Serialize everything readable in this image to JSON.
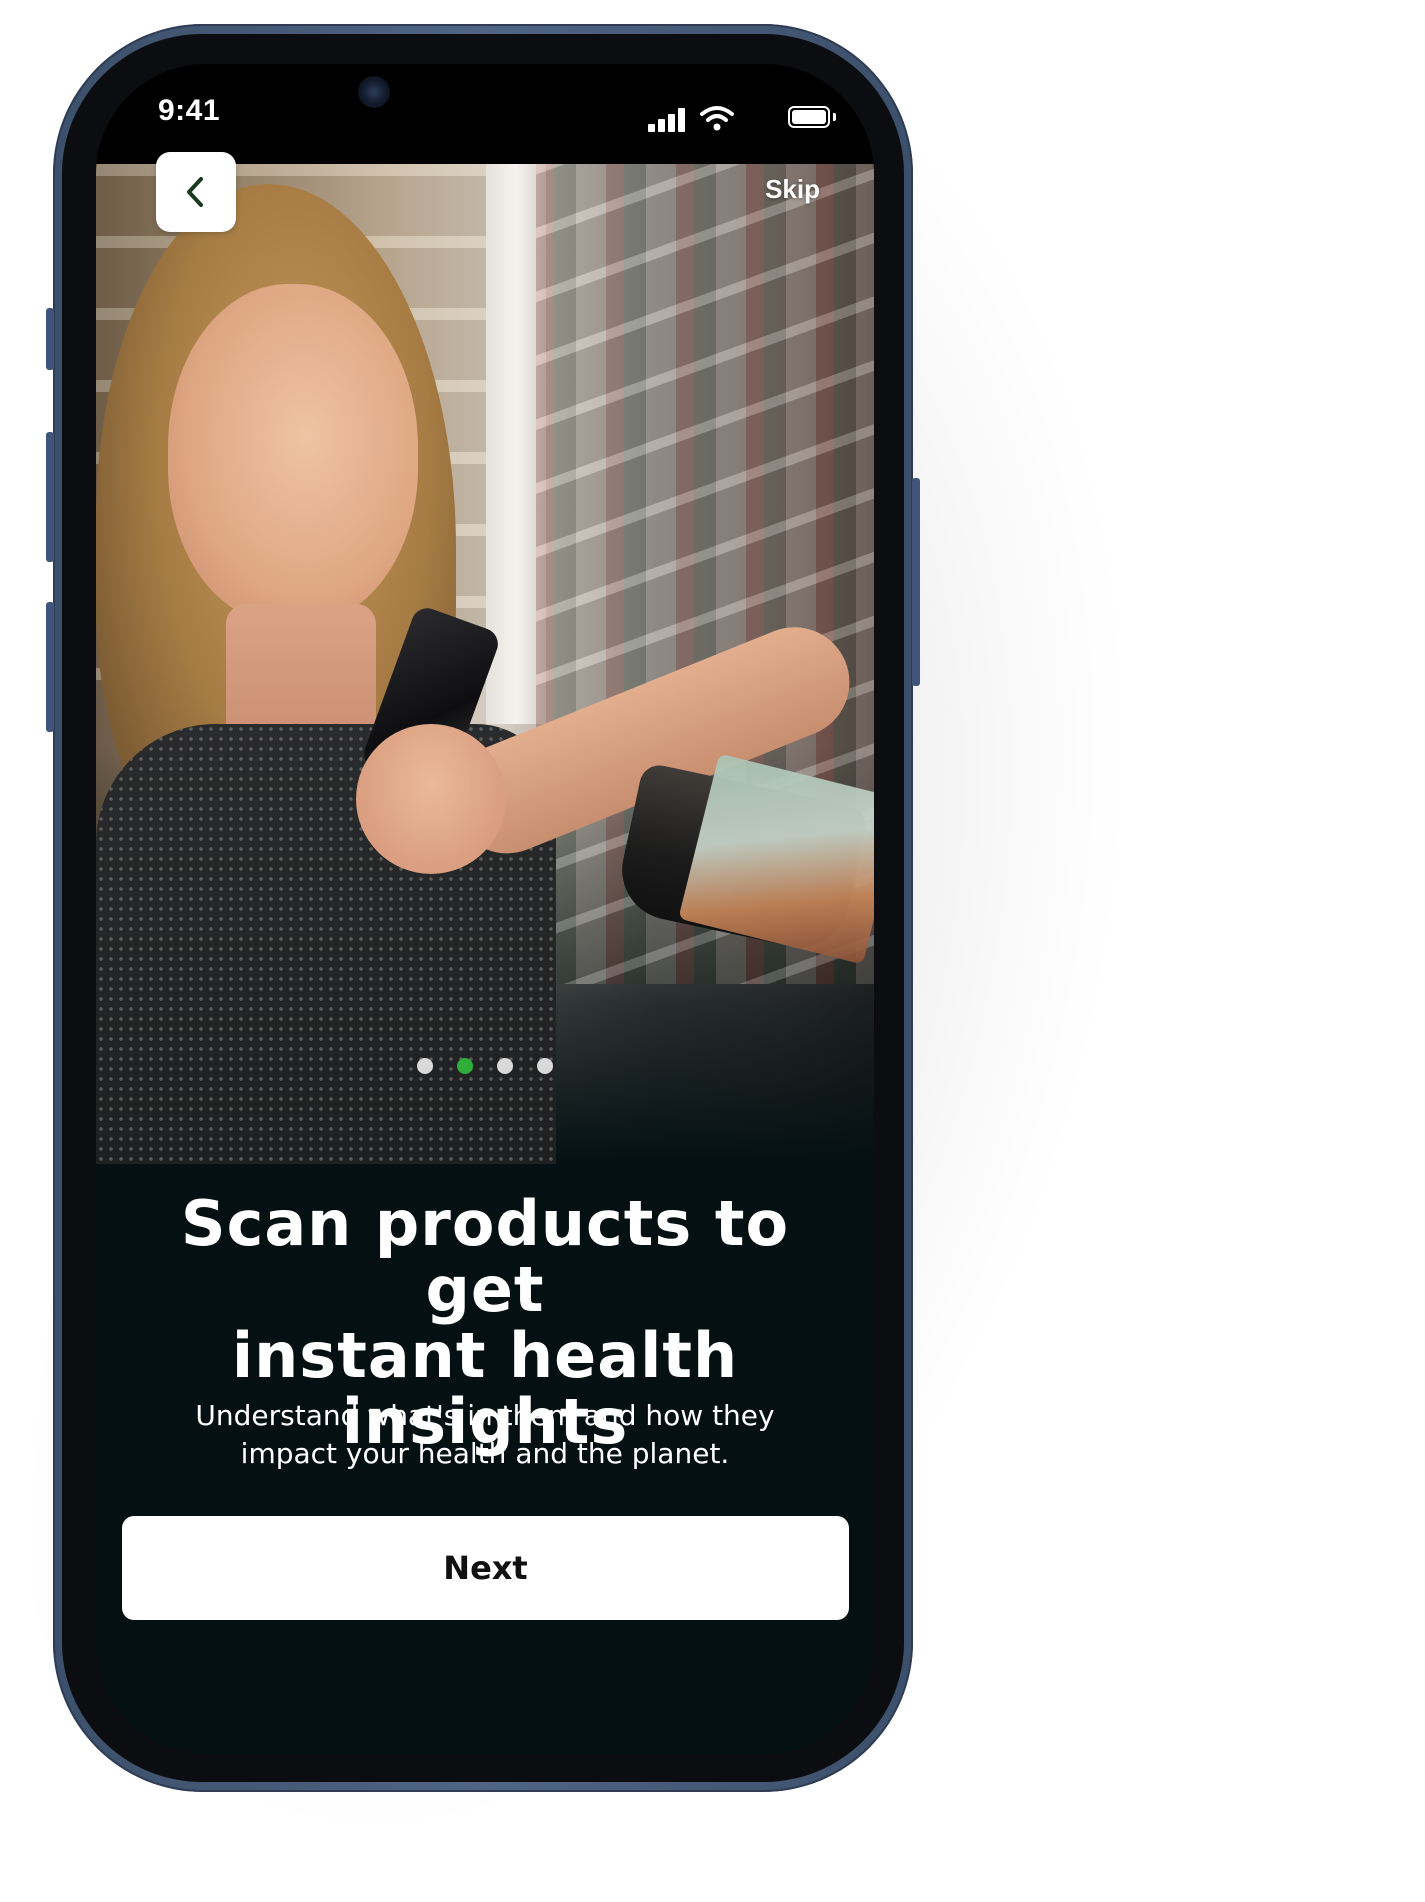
{
  "status_bar": {
    "time": "9:41",
    "icons": [
      "signal-icon",
      "wifi-icon",
      "battery-icon"
    ]
  },
  "nav": {
    "back_icon": "chevron-left-icon",
    "skip_label": "Skip"
  },
  "pagination": {
    "total": 4,
    "active_index": 1,
    "active_color": "#2fae3a",
    "inactive_color": "#d9d9d9"
  },
  "onboarding": {
    "headline_line1": "Scan products to get",
    "headline_line2": "instant health insights",
    "subtext_line1": "Understand what's in them and how they",
    "subtext_line2": "impact your health and the planet.",
    "next_label": "Next"
  },
  "colors": {
    "background_dark": "#041012",
    "phone_frame": "#3c4f6b",
    "button_bg": "#ffffff"
  }
}
